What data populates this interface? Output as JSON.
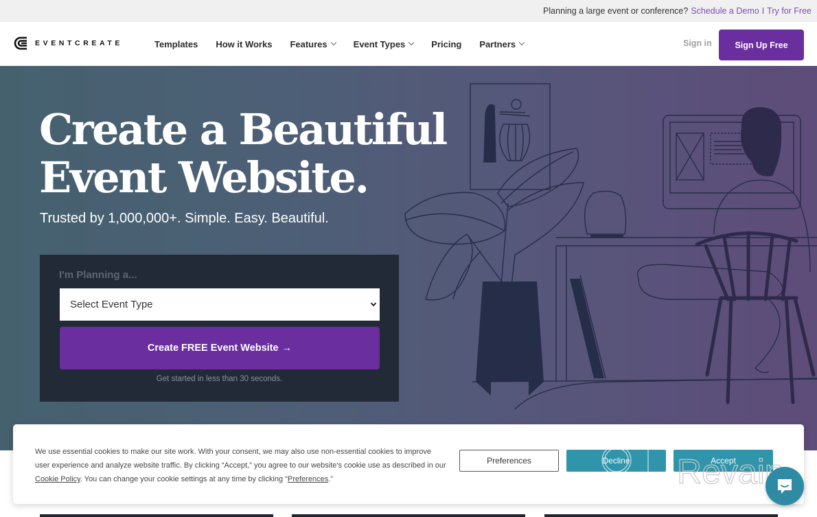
{
  "topbar": {
    "prompt": "Planning a large event or conference?",
    "demo_link": "Schedule a Demo",
    "separator": "I",
    "try_link": "Try for Free"
  },
  "nav": {
    "brand": "EVENTCREATE",
    "items": [
      {
        "label": "Templates",
        "dropdown": false
      },
      {
        "label": "How it Works",
        "dropdown": false
      },
      {
        "label": "Features",
        "dropdown": true
      },
      {
        "label": "Event Types",
        "dropdown": true
      },
      {
        "label": "Pricing",
        "dropdown": false
      },
      {
        "label": "Partners",
        "dropdown": true
      }
    ],
    "signin": "Sign in",
    "signup": "Sign Up Free"
  },
  "hero": {
    "title_line1": "Create a Beautiful",
    "title_line2": "Event Website.",
    "subtitle": "Trusted by 1,000,000+. Simple. Easy. Beautiful."
  },
  "form": {
    "label": "I'm Planning a...",
    "select_value": "Select Event Type",
    "cta": "Create FREE Event Website",
    "cta_arrow": "→",
    "note": "Get started in less than 30 seconds."
  },
  "cookie": {
    "text_part1": "We use essential cookies to make our site work. With your consent, we may also use non-essential cookies to improve user experience and analyze website traffic. By clicking “Accept,” you agree to our website's cookie use as described in our ",
    "policy_link": "Cookie Policy",
    "text_part2": ". You can change your cookie settings at any time by clicking “",
    "pref_link": "Preferences",
    "text_part3": ".”",
    "preferences_button": "Preferences",
    "decline_button": "Decline",
    "accept_button": "Accept"
  },
  "watermark": {
    "text": "Revain"
  },
  "colors": {
    "brand_purple": "#6a2e9f",
    "link_purple": "#7b4fb0",
    "cookie_teal": "#3095aa",
    "form_bg": "#212a36"
  }
}
